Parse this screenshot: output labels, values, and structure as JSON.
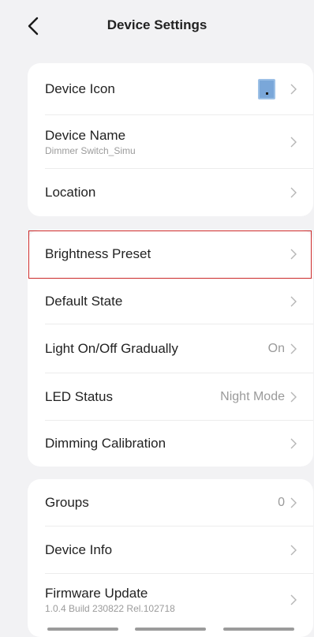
{
  "header": {
    "title": "Device Settings"
  },
  "card1": {
    "device_icon_label": "Device Icon",
    "device_name_label": "Device Name",
    "device_name_value": "Dimmer Switch_Simu",
    "location_label": "Location"
  },
  "card2": {
    "brightness_preset_label": "Brightness Preset",
    "default_state_label": "Default State",
    "light_gradual_label": "Light On/Off Gradually",
    "light_gradual_value": "On",
    "led_status_label": "LED Status",
    "led_status_value": "Night Mode",
    "dimming_calibration_label": "Dimming Calibration"
  },
  "card3": {
    "groups_label": "Groups",
    "groups_value": "0",
    "device_info_label": "Device Info",
    "firmware_label": "Firmware Update",
    "firmware_version": "1.0.4 Build 230822 Rel.102718"
  }
}
